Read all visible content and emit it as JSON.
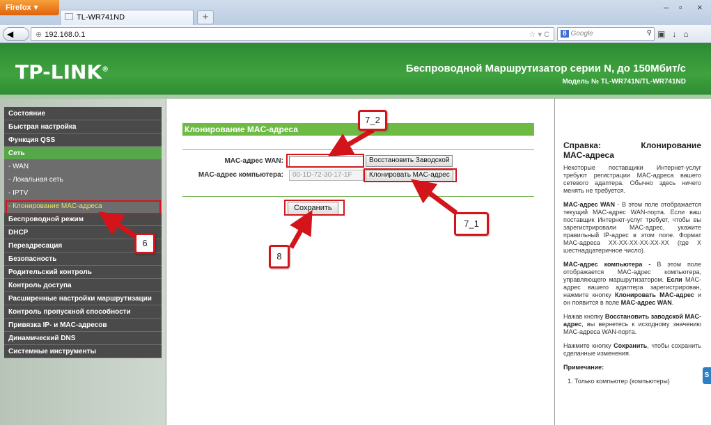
{
  "browser": {
    "menu_button": "Firefox",
    "tab_title": "TL-WR741ND",
    "new_tab": "+",
    "url": "192.168.0.1",
    "search_engine": "8",
    "search_placeholder": "Google",
    "window_controls": [
      "–",
      "▫",
      "×"
    ]
  },
  "header": {
    "logo": "TP-LINK",
    "title": "Беспроводной Маршрутизатор серии N, до 150Мбит/с",
    "model": "Модель № TL-WR741N/TL-WR741ND"
  },
  "sidebar": {
    "items": [
      {
        "label": "Состояние",
        "kind": "main"
      },
      {
        "label": "Быстрая настройка",
        "kind": "main"
      },
      {
        "label": "Функция QSS",
        "kind": "main"
      },
      {
        "label": "Сеть",
        "kind": "active"
      },
      {
        "label": "- WAN",
        "kind": "sub"
      },
      {
        "label": "- Локальная сеть",
        "kind": "sub"
      },
      {
        "label": "- IPTV",
        "kind": "sub"
      },
      {
        "label": "- Клонирование MAC-адреса",
        "kind": "selected"
      },
      {
        "label": "Беспроводной режим",
        "kind": "main"
      },
      {
        "label": "DHCP",
        "kind": "main"
      },
      {
        "label": "Переадресация",
        "kind": "main"
      },
      {
        "label": "Безопасность",
        "kind": "main"
      },
      {
        "label": "Родительский контроль",
        "kind": "main"
      },
      {
        "label": "Контроль доступа",
        "kind": "main"
      },
      {
        "label": "Расширенные настройки маршрутизации",
        "kind": "main"
      },
      {
        "label": "Контроль пропускной способности",
        "kind": "main"
      },
      {
        "label": "Привязка IP- и MAC-адресов",
        "kind": "main"
      },
      {
        "label": "Динамический DNS",
        "kind": "main"
      },
      {
        "label": "Системные инструменты",
        "kind": "main"
      }
    ]
  },
  "main": {
    "section_title": "Клонирование MAC-адреса",
    "wan_mac_label": "MAC-адрес WAN:",
    "wan_mac_value": "",
    "pc_mac_label": "MAC-адрес компьютера:",
    "pc_mac_value": "00-1D-72-30-17-1F",
    "restore_button": "Восстановить Заводской",
    "clone_button": "Клонировать MAC-адрес",
    "save_button": "Сохранить"
  },
  "help": {
    "title_left": "Справка:",
    "title_right": "Клонирование",
    "title_line2": "MAC-адреса",
    "p1": "Некоторые поставщики Интернет-услуг требуют регистрации MAC-адреса вашего сетевого адаптера. Обычно здесь ничего менять не требуется.",
    "p2_bold": "MAC-адрес WAN",
    "p2": " - В этом поле отображается текущий MAC-адрес WAN-порта. Если ваш поставщик Интернет-услуг требует, чтобы вы зарегистрировали MAC-адрес, укажите правильный IP-адрес в этом поле. Формат MAC-адреса XX-XX-XX-XX-XX-XX (где X шестнадцатеричное число).",
    "p3_bold": "MAC-адрес компьютера -",
    "p3a": " В этом поле отображается MAC-адрес компьютера, управляющего маршрутизатором. ",
    "p3_bold2": "Если",
    "p3b": " MAC-адрес вашего адаптера зарегистрирован, нажмите кнопку ",
    "p3_bold3": "Клонировать MAC-адрес",
    "p3c": " и он появится в поле ",
    "p3_bold4": "MAC-адрес WAN",
    "p3d": ".",
    "p4a": "Нажав кнопку ",
    "p4_bold": "Восстановить заводской MAC-адрес",
    "p4b": ", вы вернетесь к исходному значению MAC-адреса WAN-порта.",
    "p5a": "Нажмите кнопку ",
    "p5_bold": "Сохранить",
    "p5b": ", чтобы сохранить сделанные изменения.",
    "note_title": "Примечание:",
    "note_item": "Только компьютер (компьютеры)"
  },
  "annotations": {
    "callout_6": "6",
    "callout_7_1": "7_1",
    "callout_7_2": "7_2",
    "callout_8": "8",
    "color": "#d4141b"
  },
  "widgets": {
    "side_tab": "S"
  }
}
